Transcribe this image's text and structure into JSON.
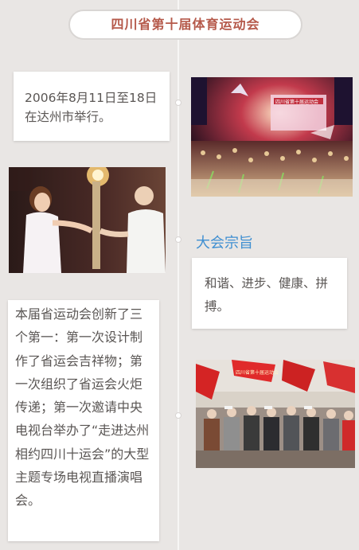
{
  "header": {
    "title": "四川省第十届体育运动会"
  },
  "timeline": {
    "event_card": {
      "text": "2006年8月11日至18日在达州市举行。"
    },
    "purpose": {
      "heading": "大会宗旨",
      "text": "和谐、进步、健康、拼搏。"
    },
    "firsts_card": {
      "text": "本届省运动会创新了三个第一：第一次设计制作了省运会吉祥物；第一次组织了省运会火炬传递；第一次邀请中央电视台举办了“走进达州相约四川十运会”的大型主题专场电视直播演唱会。"
    }
  },
  "photos": {
    "stage_banner": "四川省第十届运动会",
    "parade_banner": "四川省第十届运动会"
  }
}
